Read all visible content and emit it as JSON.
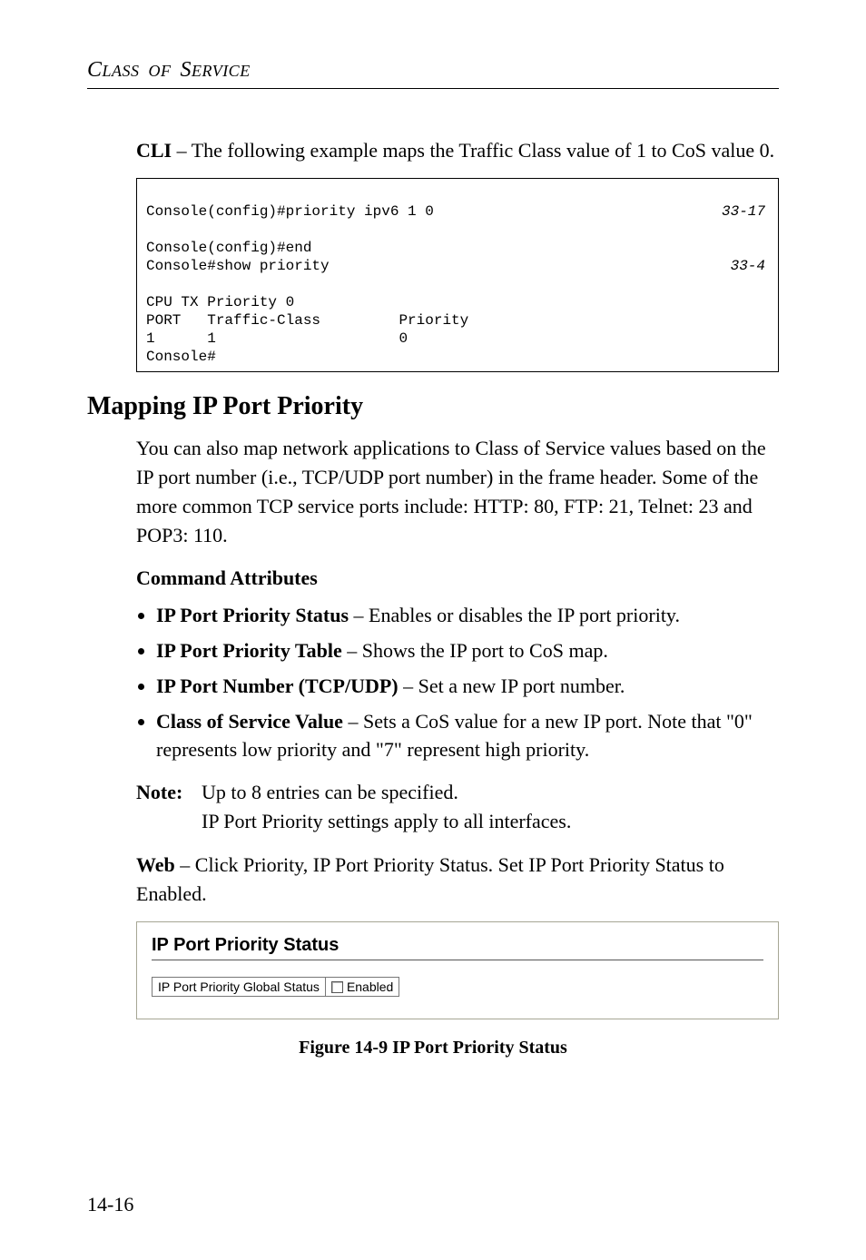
{
  "header": {
    "running": "CLASS OF SERVICE"
  },
  "intro": {
    "cli_label": "CLI",
    "cli_text": " – The following example maps the Traffic Class value of 1 to CoS value 0."
  },
  "code": {
    "line1_left": "Console(config)#priority ipv6 1 0",
    "line1_ref": "33-17",
    "line2": "Console(config)#end",
    "line3_left": "Console#show priority",
    "line3_ref": "33-4",
    "line4": "CPU TX Priority 0",
    "line5": "PORT   Traffic-Class         Priority",
    "line6": "1      1                     0",
    "line7": "Console#"
  },
  "section": {
    "title": "Mapping IP Port Priority",
    "para": "You can also map network applications to Class of Service values based on the IP port number (i.e., TCP/UDP port number) in the frame header. Some of the more common TCP service ports include: HTTP: 80, FTP: 21, Telnet: 23 and POP3: 110.",
    "cmd_attr": "Command Attributes",
    "bullets": {
      "b1_bold": "IP Port Priority Status",
      "b1_rest": " – Enables or disables the IP port priority.",
      "b2_bold": "IP Port Priority Table",
      "b2_rest": " – Shows the IP port to CoS map.",
      "b3_bold": "IP Port Number (TCP/UDP)",
      "b3_rest": " – Set a new IP port number.",
      "b4_bold": "Class of Service Value",
      "b4_rest": " – Sets a CoS value for a new IP port. Note that \"0\" represents low priority and \"7\" represent high priority."
    },
    "note": {
      "label": "Note:",
      "line1": "Up to 8 entries can be specified.",
      "line2": "IP Port Priority settings apply to all interfaces."
    },
    "web_bold": "Web",
    "web_text": " – Click Priority, IP Port Priority Status. Set IP Port Priority Status to Enabled."
  },
  "figure": {
    "title": "IP Port Priority Status",
    "row_label": "IP Port Priority Global Status",
    "checkbox_label": "Enabled",
    "caption": "Figure 14-9  IP Port Priority Status"
  },
  "footer": {
    "page": "14-16"
  }
}
